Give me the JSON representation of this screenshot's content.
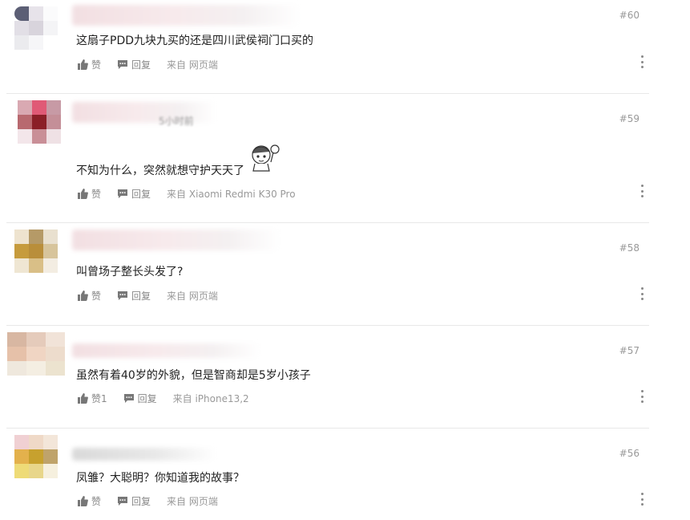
{
  "action_labels": {
    "like": "赞",
    "reply": "回复"
  },
  "comments": [
    {
      "floor": "#60",
      "meta": "",
      "text": "这扇子PDD九块九买的还是四川武侯祠门口买的",
      "likes_label": "赞",
      "reply_label": "回复",
      "source": "来自 网页端",
      "avatar_colors": [
        "#5c5f75",
        "#e7e3ea",
        "#fbfbfc",
        "#e2dfe6",
        "#d8d4dc",
        "#f4f4f6",
        "#ebebee",
        "#f6f6f8",
        "#ffffff"
      ]
    },
    {
      "floor": "#59",
      "meta": "5小时前",
      "text": "不知为什么，突然就想守护天天了",
      "likes_label": "赞",
      "reply_label": "回复",
      "source": "来自 Xiaomi  Redmi  K30  Pro",
      "avatar_colors": [
        "#d9a9b2",
        "#e05a76",
        "#c79aa5",
        "#b8696f",
        "#8b1f27",
        "#c48f98",
        "#f3e6ea",
        "#c98f97",
        "#efe1e5"
      ]
    },
    {
      "floor": "#58",
      "meta": "",
      "text": "叫曾场子整长头发了?",
      "likes_label": "赞",
      "reply_label": "回复",
      "source": "来自 网页端",
      "avatar_colors": [
        "#eee3cf",
        "#b59a67",
        "#e9e0cf",
        "#c69b3d",
        "#b98e3a",
        "#d7c49b",
        "#efe6d3",
        "#d9bf87",
        "#f3ede2"
      ]
    },
    {
      "floor": "#57",
      "meta": "",
      "text": "虽然有着40岁的外貌，但是智商却是5岁小孩子",
      "likes_label": "赞1",
      "reply_label": "回复",
      "source": "来自 iPhone13,2",
      "avatar_colors": [
        "#d8b7a2",
        "#e5cbbb",
        "#f1e3d8",
        "#e6c1a9",
        "#f0d5c3",
        "#eddccc",
        "#efe8dd",
        "#f4eee2",
        "#ece3cf"
      ]
    },
    {
      "floor": "#56",
      "meta": "",
      "text": "凤雏？大聪明？你知道我的故事？",
      "likes_label": "赞",
      "reply_label": "回复",
      "source": "来自 网页端",
      "avatar_colors": [
        "#f0d0d3",
        "#efd9c7",
        "#f3e6d9",
        "#e3b14c",
        "#c7a12e",
        "#bfa36a",
        "#eedb77",
        "#e8d68a",
        "#f6f0de"
      ]
    }
  ]
}
